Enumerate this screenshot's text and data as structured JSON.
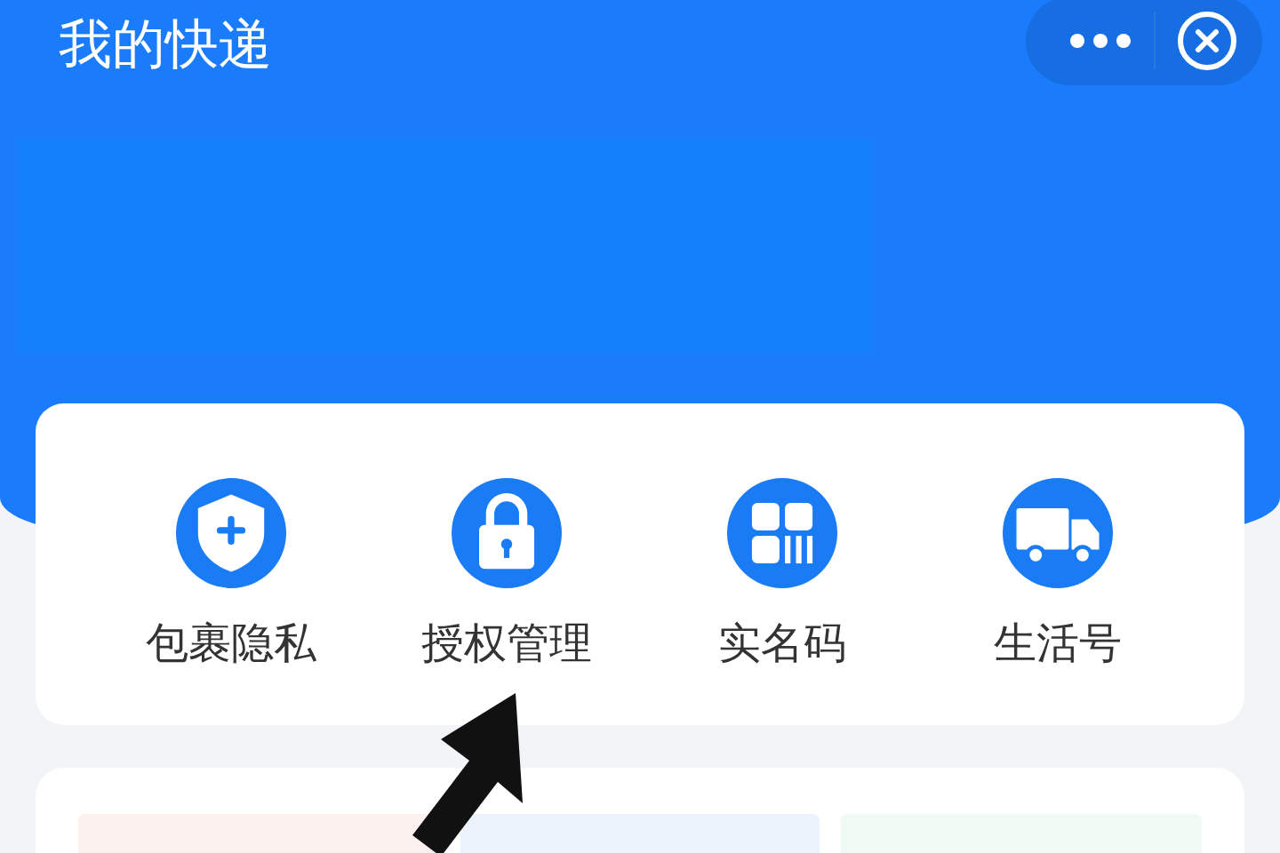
{
  "header": {
    "title": "我的快递"
  },
  "shortcuts": [
    {
      "label": "包裹隐私"
    },
    {
      "label": "授权管理"
    },
    {
      "label": "实名码"
    },
    {
      "label": "生活号"
    }
  ]
}
